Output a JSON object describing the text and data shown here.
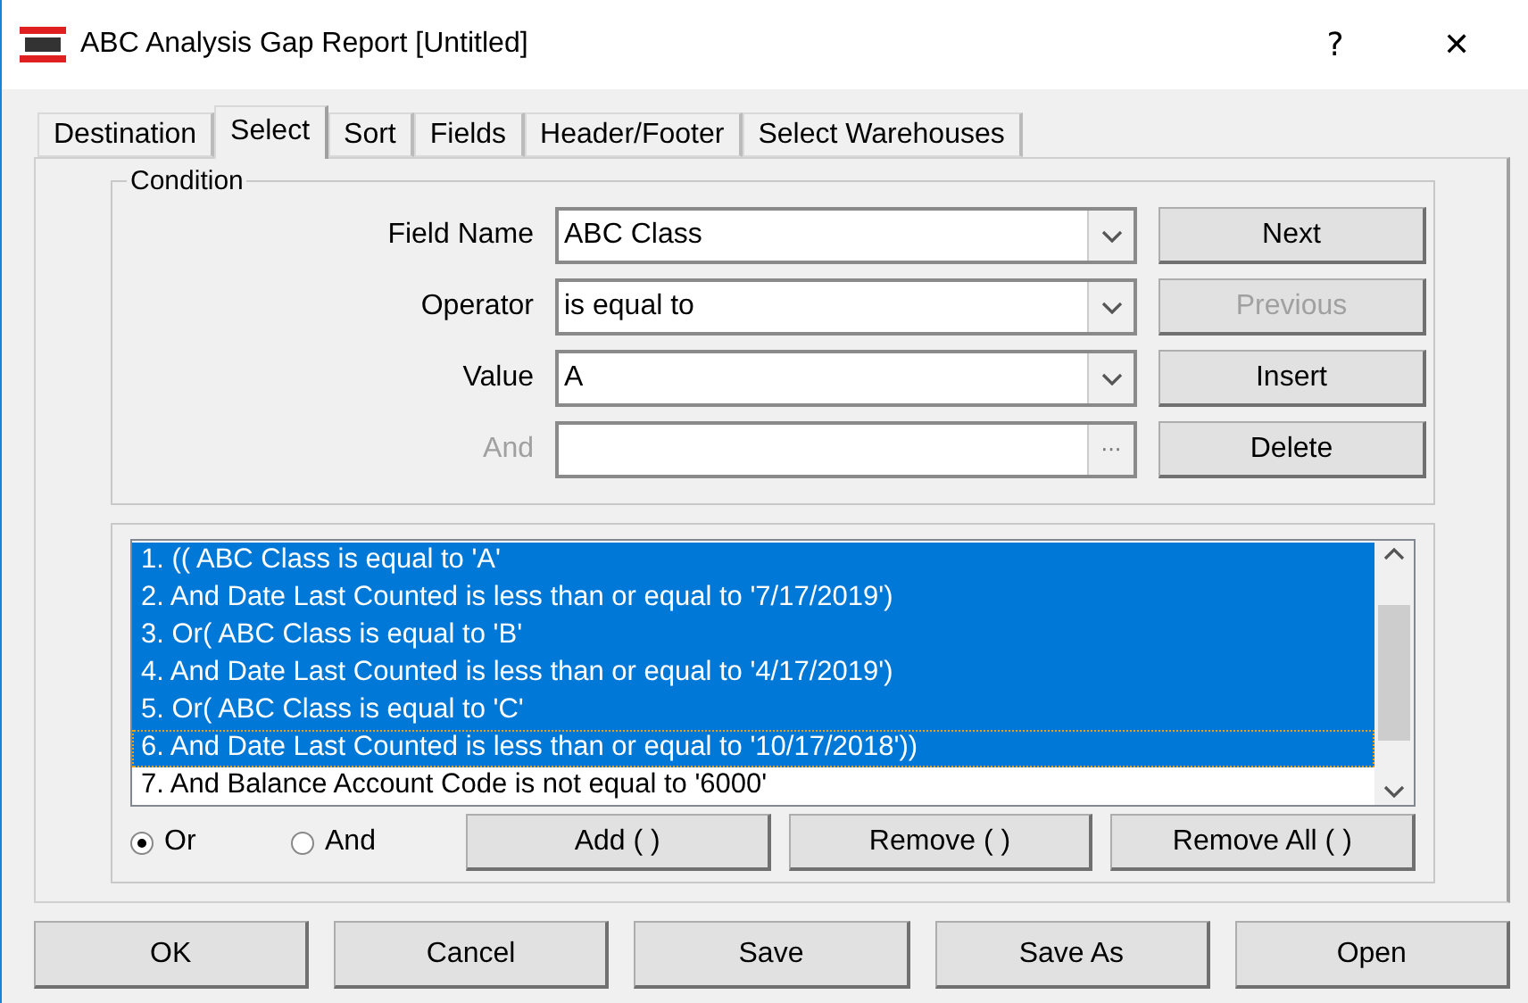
{
  "window": {
    "title": "ABC Analysis Gap Report [Untitled]",
    "help": "?",
    "close": "✕"
  },
  "tabs": [
    {
      "label": "Destination",
      "selected": false
    },
    {
      "label": "Select",
      "selected": true
    },
    {
      "label": "Sort",
      "selected": false
    },
    {
      "label": "Fields",
      "selected": false
    },
    {
      "label": "Header/Footer",
      "selected": false
    },
    {
      "label": "Select Warehouses",
      "selected": false
    }
  ],
  "condition": {
    "title": "Condition",
    "fields": [
      {
        "label": "Field Name",
        "value": "ABC Class",
        "kind": "dropdown",
        "disabled": false
      },
      {
        "label": "Operator",
        "value": "is equal to",
        "kind": "dropdown",
        "disabled": false
      },
      {
        "label": "Value",
        "value": "A",
        "kind": "dropdown",
        "disabled": false
      },
      {
        "label": "And",
        "kind": "browse",
        "disabled": true,
        "browse": "···"
      }
    ],
    "buttons": [
      {
        "label": "Next",
        "disabled": false
      },
      {
        "label": "Previous",
        "disabled": true
      },
      {
        "label": "Insert",
        "disabled": false
      },
      {
        "label": "Delete",
        "disabled": false
      }
    ]
  },
  "list": {
    "items": [
      {
        "text": "1.  (( ABC Class is equal to 'A'",
        "selected": true,
        "focused": false
      },
      {
        "text": "2.  And Date Last Counted is less than or equal to '7/17/2019')",
        "selected": true,
        "focused": false
      },
      {
        "text": "3.  Or( ABC Class is equal to 'B'",
        "selected": true,
        "focused": false
      },
      {
        "text": "4.  And Date Last Counted is less than or equal to '4/17/2019')",
        "selected": true,
        "focused": false
      },
      {
        "text": "5.  Or( ABC Class is equal to 'C'",
        "selected": true,
        "focused": false
      },
      {
        "text": "6.  And Date Last Counted is less than or equal to '10/17/2018'))",
        "selected": true,
        "focused": true
      },
      {
        "text": "7.  And Balance Account Code is not equal to '6000'",
        "selected": false,
        "focused": false
      }
    ],
    "radios": [
      {
        "label": "Or",
        "selected": true
      },
      {
        "label": "And",
        "selected": false
      }
    ],
    "buttons": [
      {
        "label": "Add ( )"
      },
      {
        "label": "Remove ( )"
      },
      {
        "label": "Remove All ( )"
      }
    ]
  },
  "footer": [
    {
      "label": "OK"
    },
    {
      "label": "Cancel"
    },
    {
      "label": "Save"
    },
    {
      "label": "Save As"
    },
    {
      "label": "Open"
    }
  ]
}
